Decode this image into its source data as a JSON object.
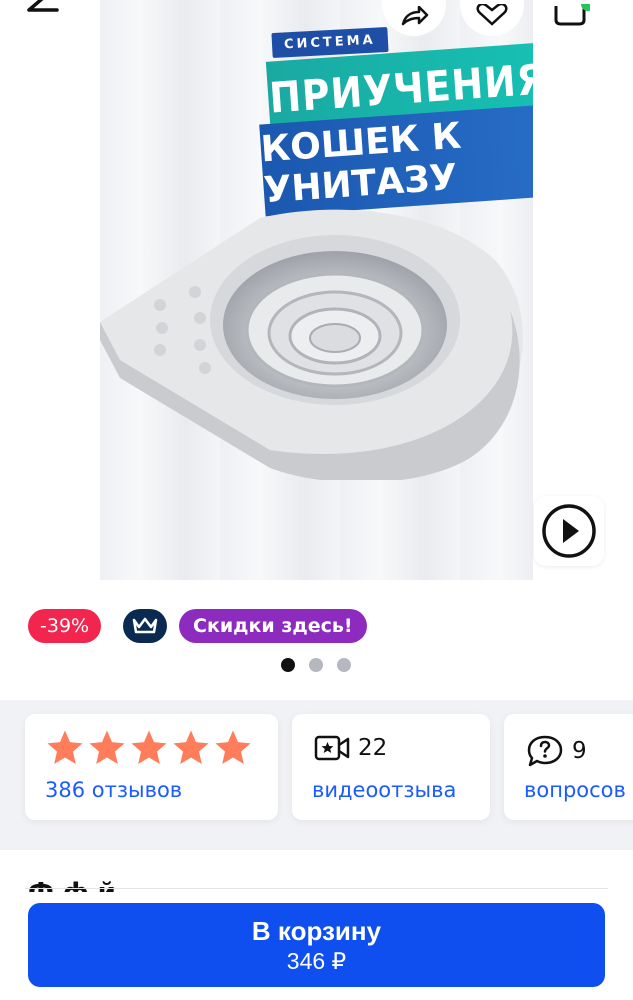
{
  "product_image": {
    "headline_small": "СИСТЕМА",
    "headline_line1": "ПРИУЧЕНИЯ",
    "headline_line2": "КОШЕК К УНИТАЗУ"
  },
  "badges": {
    "discount": "-39%",
    "promo": "Скидки здесь!"
  },
  "gallery": {
    "total_slides": 3,
    "active_slide": 1
  },
  "stats": {
    "rating_stars": 5,
    "reviews": "386 отзывов",
    "video_reviews_count": "22",
    "video_reviews_label": "видеоотзыва",
    "questions_count": "9",
    "questions_label": "вопросов"
  },
  "product_title_peek": "Ф                    ф                              й",
  "cart": {
    "label": "В корзину",
    "price": "346 ₽"
  },
  "colors": {
    "accent_blue": "#0f4ff0",
    "discount_red": "#f2254e",
    "promo_purple": "#8c2bbd",
    "star_orange": "#ff7d5a"
  }
}
